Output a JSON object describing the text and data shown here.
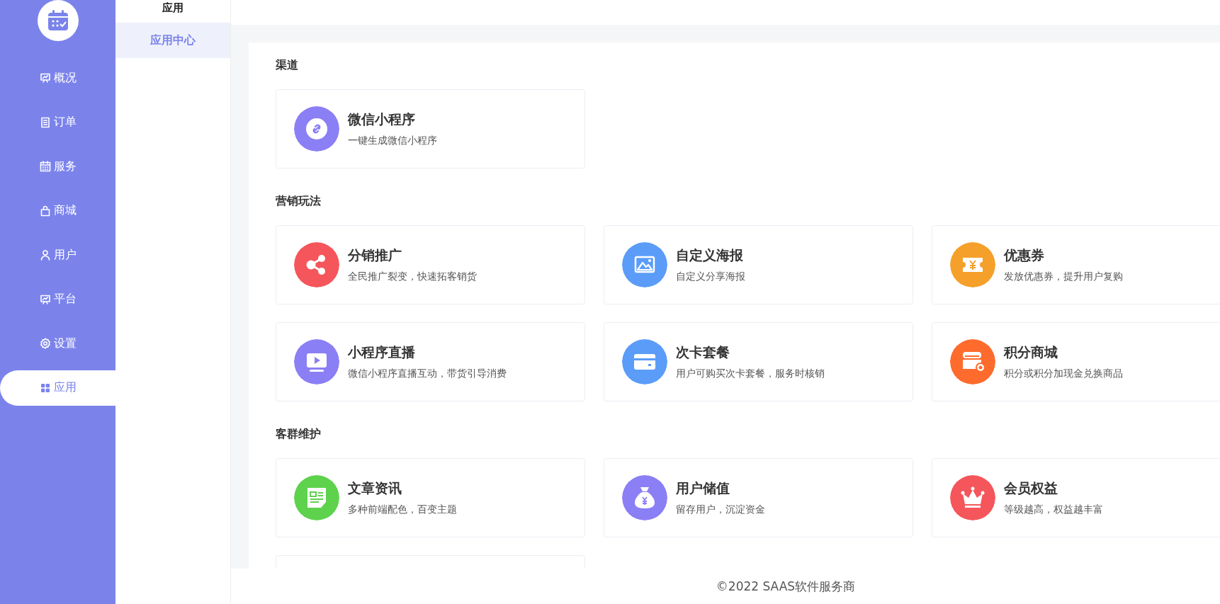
{
  "sidebar": {
    "items": [
      {
        "label": "概况",
        "selected": false
      },
      {
        "label": "订单",
        "selected": false
      },
      {
        "label": "服务",
        "selected": false
      },
      {
        "label": "商城",
        "selected": false
      },
      {
        "label": "用户",
        "selected": false
      },
      {
        "label": "平台",
        "selected": false
      },
      {
        "label": "设置",
        "selected": false
      },
      {
        "label": "应用",
        "selected": true
      }
    ]
  },
  "subnav": {
    "title": "应用",
    "items": [
      {
        "label": "应用中心",
        "selected": true
      }
    ]
  },
  "sections": [
    {
      "title": "渠道",
      "apps": [
        {
          "kind": "app",
          "name": "微信小程序",
          "desc": "一键生成微信小程序",
          "color": "#8b7ff5"
        }
      ]
    },
    {
      "title": "营销玩法",
      "apps": [
        {
          "kind": "app",
          "name": "分销推广",
          "desc": "全民推广裂变，快速拓客销货",
          "color": "#f5565b"
        },
        {
          "kind": "app",
          "name": "自定义海报",
          "desc": "自定义分享海报",
          "color": "#5b9cf8"
        },
        {
          "kind": "app",
          "name": "优惠券",
          "desc": "发放优惠券，提升用户复购",
          "color": "#f5a02a"
        },
        {
          "kind": "app",
          "name": "小程序直播",
          "desc": "微信小程序直播互动，带货引导消费",
          "color": "#8b7ff5"
        },
        {
          "kind": "app",
          "name": "次卡套餐",
          "desc": "用户可购买次卡套餐，服务时核销",
          "color": "#5b9cf8"
        },
        {
          "kind": "app",
          "name": "积分商城",
          "desc": "积分或积分加现金兑换商品",
          "color": "#ff6b2c"
        }
      ]
    },
    {
      "title": "客群维护",
      "apps": [
        {
          "kind": "app",
          "name": "文章资讯",
          "desc": "多种前端配色，百变主题",
          "color": "#5ed24d"
        },
        {
          "kind": "app",
          "name": "用户储值",
          "desc": "留存用户，沉淀资金",
          "color": "#8b7ff5"
        },
        {
          "kind": "app",
          "name": "会员权益",
          "desc": "等级越高，权益越丰富",
          "color": "#f5565b"
        },
        {
          "kind": "empty"
        }
      ]
    }
  ],
  "footer": "©2022 SAAS软件服务商"
}
